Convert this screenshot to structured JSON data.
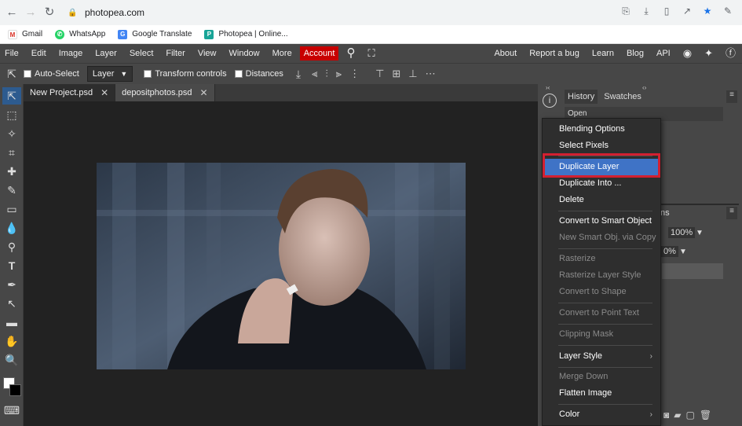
{
  "browser": {
    "url": "photopea.com",
    "bookmarks": [
      "Gmail",
      "WhatsApp",
      "Google Translate",
      "Photopea | Online..."
    ]
  },
  "menubar": {
    "items": [
      "File",
      "Edit",
      "Image",
      "Layer",
      "Select",
      "Filter",
      "View",
      "Window",
      "More"
    ],
    "account": "Account",
    "right_links": [
      "About",
      "Report a bug",
      "Learn",
      "Blog",
      "API"
    ]
  },
  "toolopts": {
    "auto_select": "Auto-Select",
    "layer_dropdown": "Layer",
    "transform_controls": "Transform controls",
    "distances": "Distances"
  },
  "doctabs": [
    "New Project.psd",
    "depositphotos.psd"
  ],
  "panel": {
    "tabs": [
      "History",
      "Swatches"
    ],
    "history_rows": [
      "Open"
    ],
    "opacity": "100%",
    "fill": "0%",
    "partial_label": "ns"
  },
  "context_menu": {
    "items": [
      {
        "label": "Blending Options",
        "disabled": false
      },
      {
        "label": "Select Pixels",
        "disabled": false
      },
      {
        "label": "Duplicate Layer",
        "disabled": false,
        "highlighted": true
      },
      {
        "label": "Duplicate Into ...",
        "disabled": false
      },
      {
        "label": "Delete",
        "disabled": false
      },
      {
        "label": "Convert to Smart Object",
        "disabled": false
      },
      {
        "label": "New Smart Obj. via Copy",
        "disabled": true
      },
      {
        "label": "Rasterize",
        "disabled": true
      },
      {
        "label": "Rasterize Layer Style",
        "disabled": true
      },
      {
        "label": "Convert to Shape",
        "disabled": true
      },
      {
        "label": "Convert to Point Text",
        "disabled": true
      },
      {
        "label": "Clipping Mask",
        "disabled": true
      },
      {
        "label": "Layer Style",
        "disabled": false,
        "submenu": true
      },
      {
        "label": "Merge Down",
        "disabled": true
      },
      {
        "label": "Flatten Image",
        "disabled": false
      },
      {
        "label": "Color",
        "disabled": false,
        "submenu": true
      }
    ]
  },
  "colors": {
    "accent_account": "#c80000",
    "highlight": "#3f73c6",
    "highlight_box": "#d32030"
  }
}
